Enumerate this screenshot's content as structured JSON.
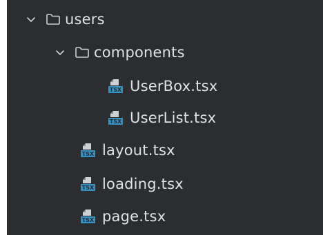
{
  "tree": {
    "users": {
      "label": "users",
      "icon": "folder-icon",
      "expanded": true
    },
    "components": {
      "label": "components",
      "icon": "folder-icon",
      "expanded": true
    },
    "files": [
      {
        "label": "UserBox.tsx",
        "icon": "tsx-file-icon"
      },
      {
        "label": "UserList.tsx",
        "icon": "tsx-file-icon"
      },
      {
        "label": "layout.tsx",
        "icon": "tsx-file-icon"
      },
      {
        "label": "loading.tsx",
        "icon": "tsx-file-icon"
      },
      {
        "label": "page.tsx",
        "icon": "tsx-file-icon"
      }
    ],
    "file_badge_text": "TSX"
  },
  "colors": {
    "background": "#2b2d30",
    "text": "#dfe1e5",
    "icon_stroke": "#ced0d6",
    "tsx_badge": "#3592c4"
  }
}
